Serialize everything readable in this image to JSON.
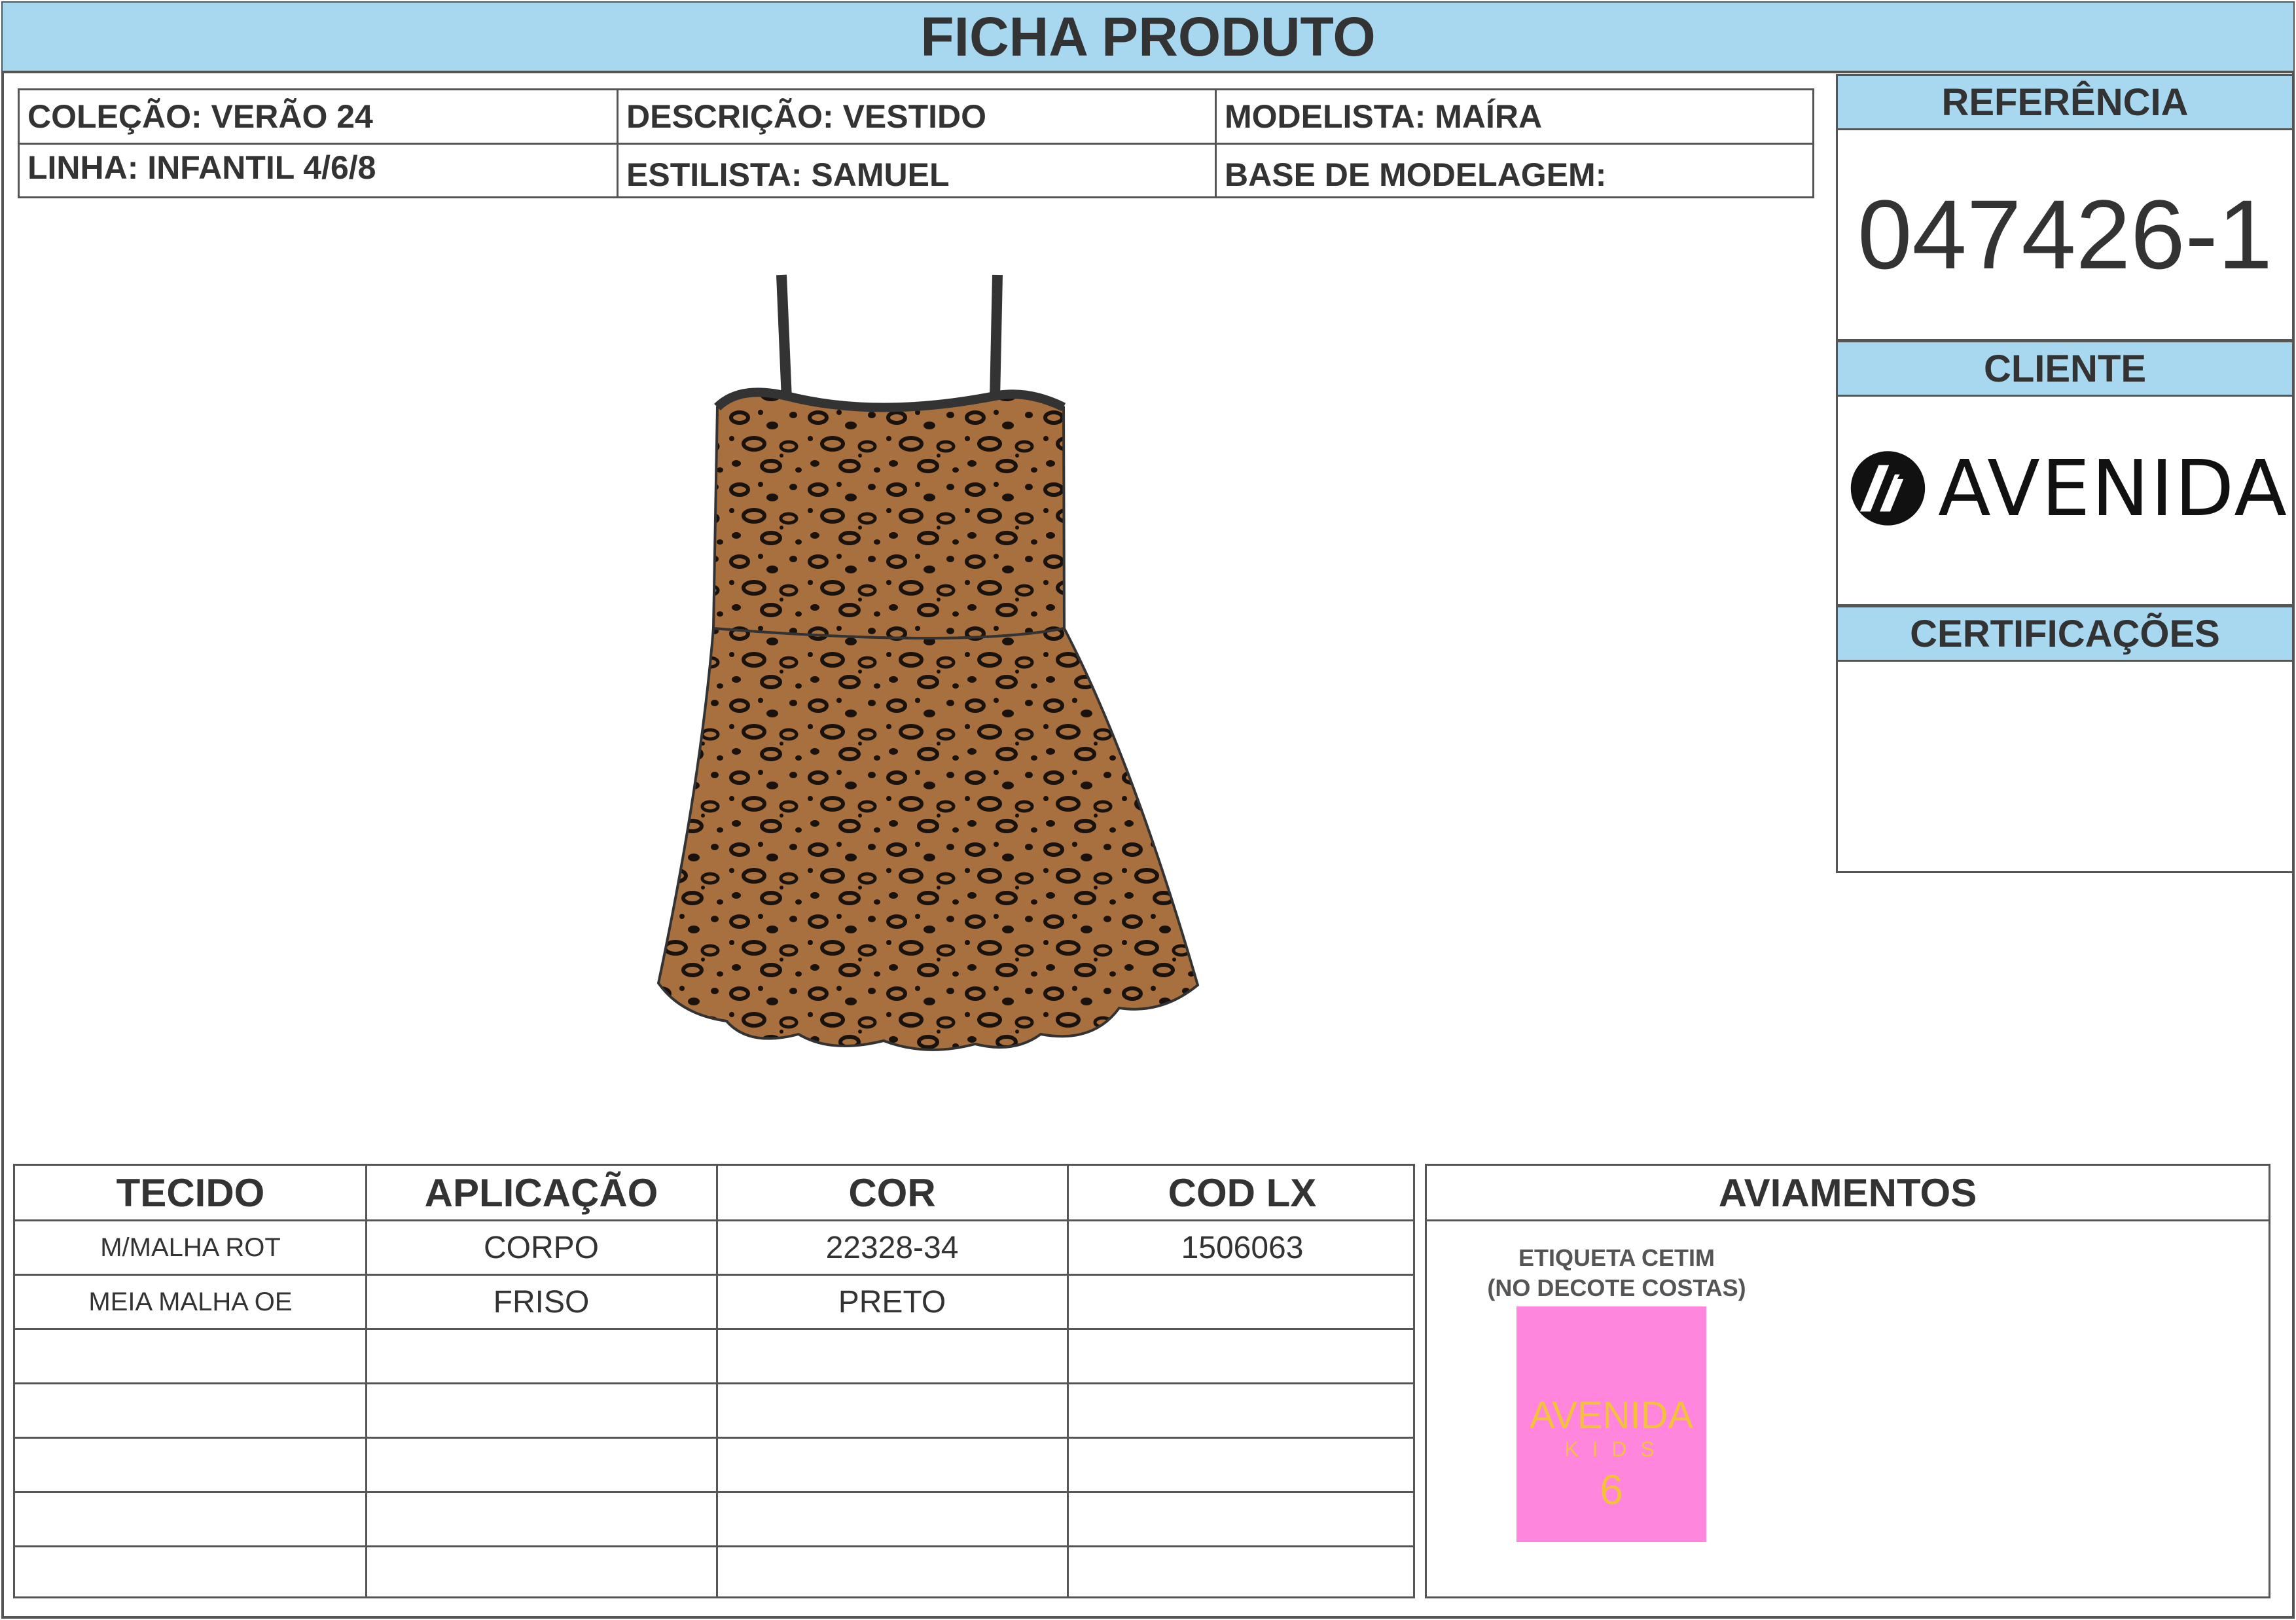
{
  "header": {
    "title": "FICHA PRODUTO"
  },
  "info": {
    "colecao": "COLEÇÃO: VERÃO 24",
    "descricao": "DESCRIÇÃO: VESTIDO",
    "modelista": "MODELISTA: MAÍRA",
    "linha": "LINHA: INFANTIL 4/6/8",
    "estilista": "ESTILISTA: SAMUEL",
    "base": "BASE DE MODELAGEM:"
  },
  "sidebar": {
    "referencia_label": "REFERÊNCIA",
    "referencia_value": "047426-1",
    "cliente_label": "CLIENTE",
    "cliente_logo_text": "AVENIDA",
    "certificacoes_label": "CERTIFICAÇÕES"
  },
  "fabric_table": {
    "headers": [
      "TECIDO",
      "APLICAÇÃO",
      "COR",
      "COD LX"
    ],
    "rows": [
      [
        "M/MALHA ROT",
        "CORPO",
        "22328-34",
        "1506063"
      ],
      [
        "MEIA MALHA OE",
        "FRISO",
        "PRETO",
        ""
      ],
      [
        "",
        "",
        "",
        ""
      ],
      [
        "",
        "",
        "",
        ""
      ],
      [
        "",
        "",
        "",
        ""
      ],
      [
        "",
        "",
        "",
        ""
      ],
      [
        "",
        "",
        "",
        ""
      ]
    ]
  },
  "trims": {
    "title": "AVIAMENTOS",
    "label_line1": "ETIQUETA CETIM",
    "label_line2": "(NO DECOTE COSTAS)",
    "tag_brand": "AVENIDA",
    "tag_sub": "K I D S",
    "tag_size": "6"
  },
  "colors": {
    "header_blue": "#a8d8f0",
    "print_base": "#a8703f",
    "tag_pink": "#ff86dc",
    "tag_text": "#f2c23a"
  },
  "icons": [
    "avenida-logo-icon",
    "dress-illustration"
  ]
}
